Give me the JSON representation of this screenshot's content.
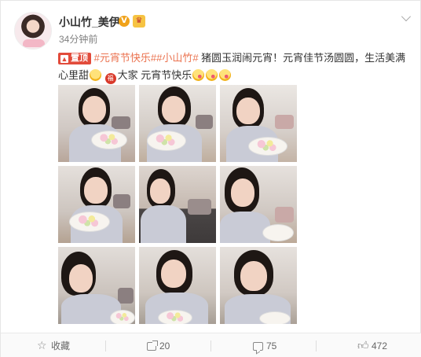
{
  "post": {
    "username": "小山竹_美伊",
    "verified_badge": "V",
    "time": "34分钟前",
    "pin_label": "置顶",
    "tags": [
      "#元宵节快乐#",
      "#小山竹#"
    ],
    "text_main": " 猪圆玉润闹元宵！元宵佳节汤圆圆，生活美满心里甜",
    "text_tail": "大家 元宵节快乐",
    "photos": [
      "photo-1",
      "photo-2",
      "photo-3",
      "photo-4",
      "photo-5",
      "photo-6",
      "photo-7",
      "photo-8",
      "photo-9"
    ]
  },
  "footer": {
    "favorite_label": "收藏",
    "repost_count": "20",
    "comment_count": "75",
    "like_count": "472"
  },
  "icons": {
    "menu": "chevron-down-icon",
    "favorite": "star-icon",
    "repost": "share-icon",
    "comment": "comment-icon",
    "like": "thumbs-up-icon"
  },
  "colors": {
    "tag": "#eb7350",
    "pin": "#e24b3b",
    "verified": "#f0a21a"
  }
}
